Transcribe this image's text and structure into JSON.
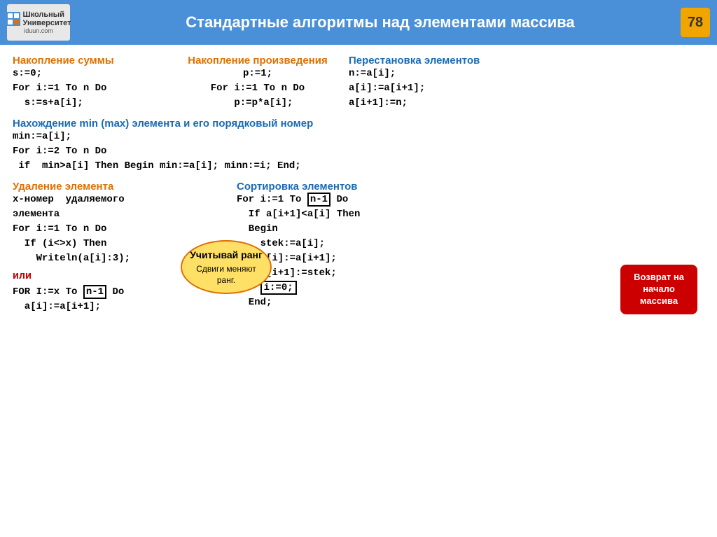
{
  "header": {
    "logo_line1": "Школьный",
    "logo_line2": "Университет",
    "logo_url": "iduun.com",
    "title": "Стандартные алгоритмы над элементами массива",
    "page_number": "78"
  },
  "sections": {
    "sum_title": "Накопление суммы",
    "sum_code": [
      "s:=0;",
      "For i:=1 To n Do",
      "  s:=s+a[i];"
    ],
    "prod_title": "Накопление произведения",
    "prod_code": [
      "p:=1;",
      "For i:=1 To n Do",
      "  p:=p*a[i];"
    ],
    "swap_title": "Перестановка элементов",
    "swap_code": [
      "n:=a[i];",
      "a[i]:=a[i+1];",
      "a[i+1]:=n;"
    ],
    "min_title": "Нахождение  min (max) элемента и его порядковый номер",
    "min_code": [
      "min:=a[i];",
      "For i:=2 To n Do",
      " if  min>a[i] Then Begin min:=a[i]; minn:=i; End;"
    ],
    "del_title": "Удаление элемента",
    "del_code": [
      "x-номер  удаляемого",
      "элемента",
      "For i:=1 To n Do",
      "  If (i<>x) Then",
      "    Writeln(a[i]:3);",
      "или",
      "FOR I:=x To n-1 Do",
      "  a[i]:=a[i+1];"
    ],
    "sort_title": "Сортировка элементов",
    "sort_code": [
      "For i:=1 To n-1 Do",
      "  If a[i+1]<a[i] Then",
      "  Begin",
      "    stek:=a[i];",
      "    a[i]:=a[i+1];",
      "    a[i+1]:=stek;",
      "    i:=0;",
      "  End;"
    ],
    "bubble_text": "Учитывай ранг",
    "bubble_sub": "Сдвиги меняют ранг.",
    "return_text": "Возврат на начало массива"
  }
}
